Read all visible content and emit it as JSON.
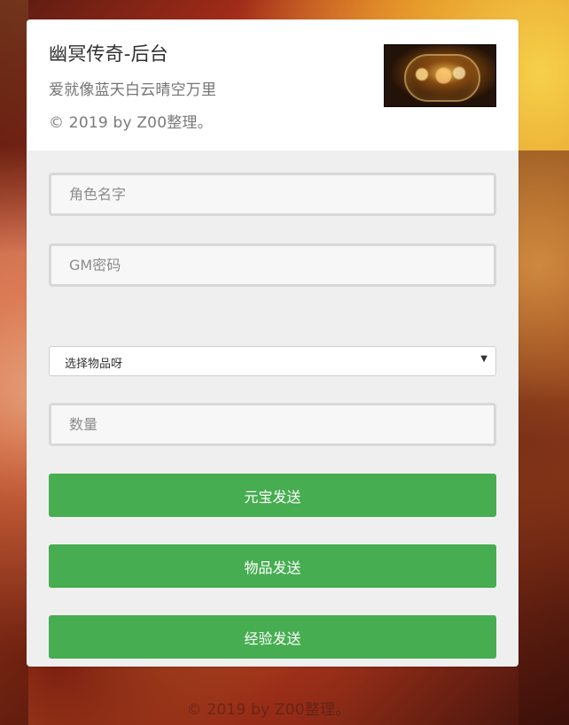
{
  "header": {
    "title": "幽冥传奇-后台",
    "subtitle": "爱就像蓝天白云晴空万里",
    "copyright": "© 2019 by Z00整理。",
    "logo_icon": "game-logo"
  },
  "form": {
    "role_name": {
      "placeholder": "角色名字",
      "value": ""
    },
    "gm_password": {
      "placeholder": "GM密码",
      "value": ""
    },
    "item_select": {
      "selected": "选择物品呀",
      "caret_icon": "chevron-down-icon"
    },
    "quantity": {
      "placeholder": "数量",
      "value": ""
    }
  },
  "buttons": {
    "send_gold": "元宝发送",
    "send_item": "物品发送",
    "send_exp": "经验发送"
  },
  "footer": {
    "copyright": "© 2019 by Z00整理。"
  },
  "colors": {
    "button_bg": "#47ad51",
    "panel_bg": "#efefef",
    "header_bg": "#ffffff"
  }
}
